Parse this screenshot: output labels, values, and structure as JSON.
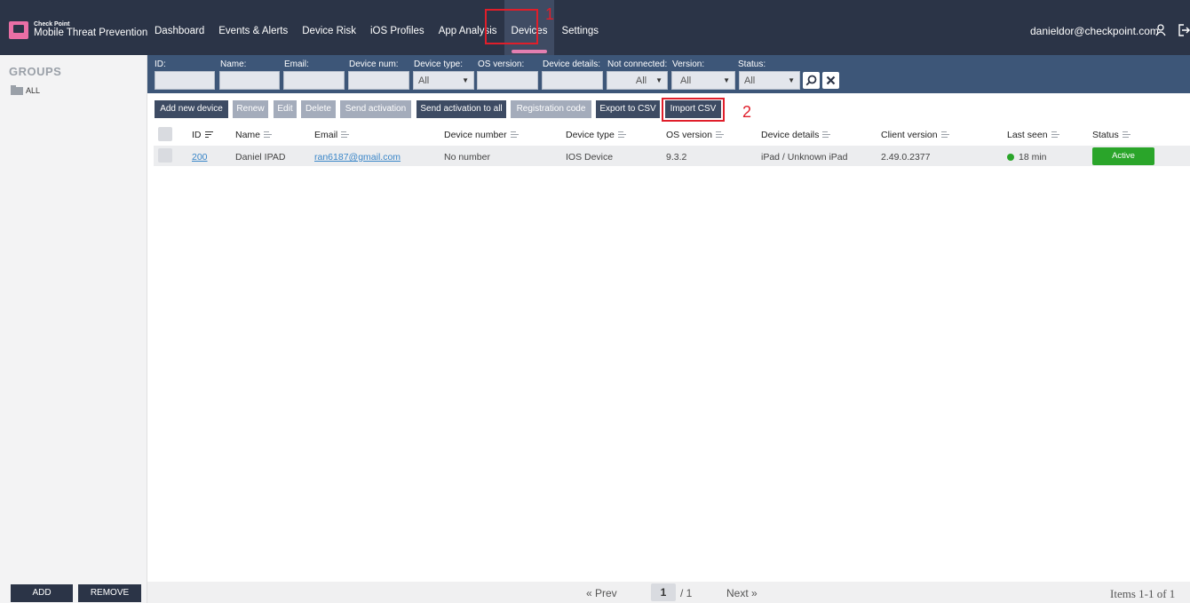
{
  "brand": {
    "small": "Check Point",
    "big": "Mobile Threat Prevention"
  },
  "nav": [
    "Dashboard",
    "Events & Alerts",
    "Device Risk",
    "iOS Profiles",
    "App Analysis",
    "Devices",
    "Settings"
  ],
  "user": {
    "email": "danieldor@checkpoint.com"
  },
  "annotations": [
    "1",
    "2"
  ],
  "sidebar": {
    "title": "GROUPS",
    "group_all": "ALL",
    "add": "ADD",
    "remove": "REMOVE"
  },
  "filters": {
    "labels": [
      "ID:",
      "Name:",
      "Email:",
      "Device num:",
      "Device type:",
      "OS version:",
      "Device details:",
      "Not connected:",
      "Version:",
      "Status:"
    ],
    "selects": [
      "All",
      "All",
      "All",
      "All"
    ]
  },
  "toolbar": [
    "Add new device",
    "Renew",
    "Edit",
    "Delete",
    "Send activation",
    "Send activation to all",
    "Registration code",
    "Export to CSV",
    "Import CSV"
  ],
  "table": {
    "headers": [
      "ID",
      "Name",
      "Email",
      "Device number",
      "Device type",
      "OS version",
      "Device details",
      "Client version",
      "Last seen",
      "Status"
    ],
    "row": {
      "id": "200",
      "name": "Daniel IPAD",
      "email": "ran6187@gmail.com",
      "device_number": "No number",
      "device_type": "IOS Device",
      "os_version": "9.3.2",
      "device_details": "iPad / Unknown iPad",
      "client_version": "2.49.0.2377",
      "last_seen": "18 min",
      "status": "Active"
    }
  },
  "pager": {
    "prev": "« Prev",
    "page": "1",
    "total": "/ 1",
    "next": "Next »",
    "items": "Items 1-1 of 1"
  }
}
